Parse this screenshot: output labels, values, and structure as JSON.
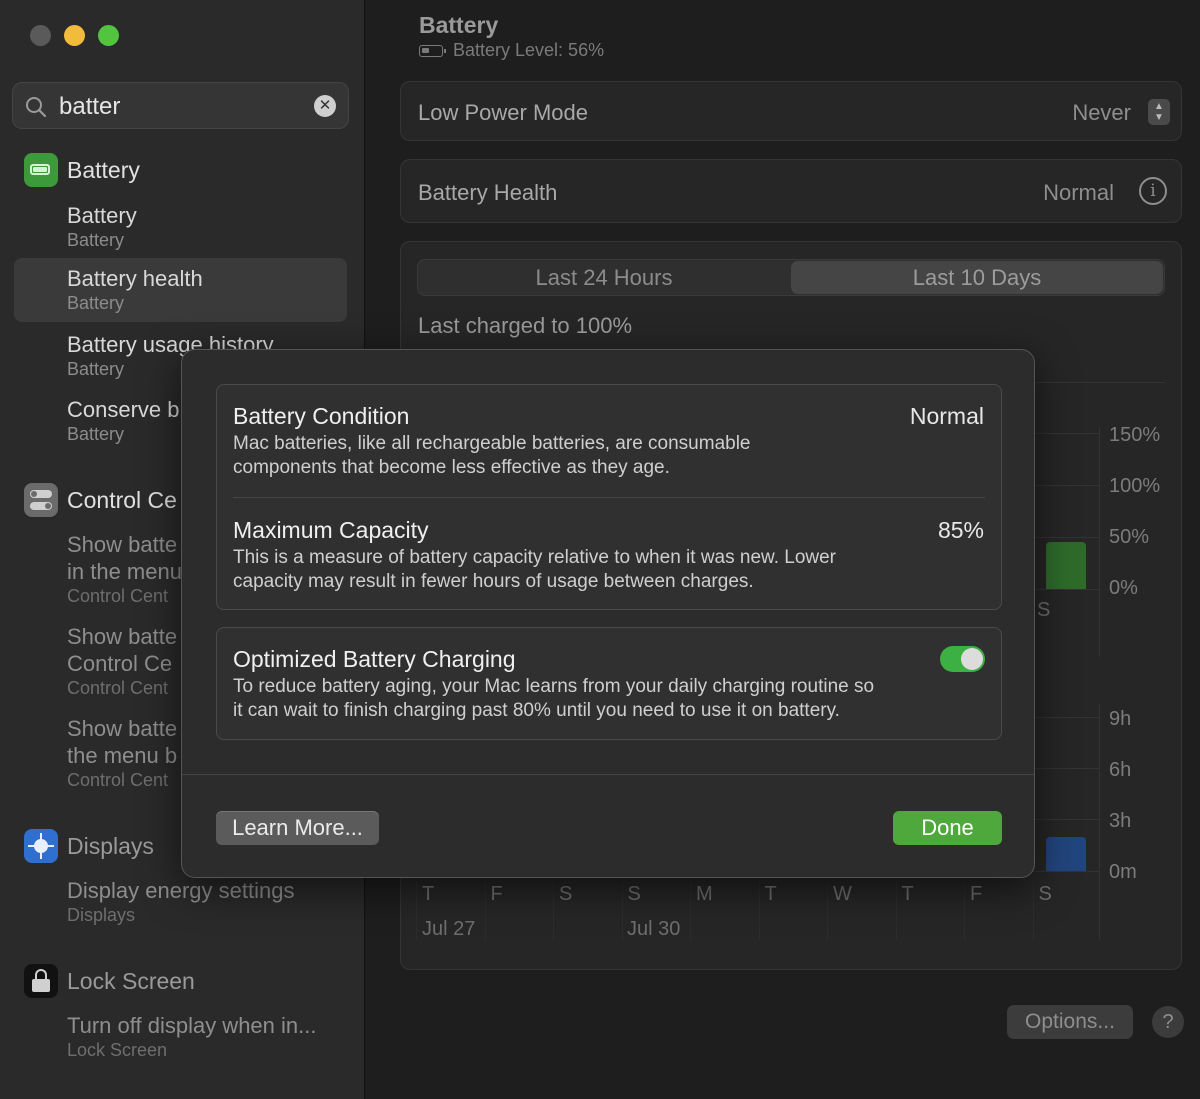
{
  "search": {
    "query": "batter"
  },
  "sidebar": {
    "groups": [
      {
        "label": "Battery",
        "items": [
          {
            "title": "Battery",
            "subtitle": "Battery"
          },
          {
            "title": "Battery health",
            "subtitle": "Battery"
          },
          {
            "title": "Battery usage history",
            "subtitle": "Battery"
          },
          {
            "title": "Conserve b",
            "subtitle": "Battery"
          }
        ]
      },
      {
        "label": "Control Ce",
        "items": [
          {
            "title": "Show batte",
            "title2": "in the menu",
            "subtitle": "Control Cent"
          },
          {
            "title": "Show batte",
            "title2": "Control Ce",
            "subtitle": "Control Cent"
          },
          {
            "title": "Show batte",
            "title2": "the menu b",
            "subtitle": "Control Cent"
          }
        ]
      },
      {
        "label": "Displays",
        "items": [
          {
            "title": "Display energy settings",
            "subtitle": "Displays"
          }
        ]
      },
      {
        "label": "Lock Screen",
        "items": [
          {
            "title": "Turn off display when in...",
            "subtitle": "Lock Screen"
          }
        ]
      }
    ]
  },
  "main": {
    "title": "Battery",
    "battery_level": "Battery Level: 56%",
    "low_power": {
      "label": "Low Power Mode",
      "value": "Never"
    },
    "health": {
      "label": "Battery Health",
      "value": "Normal"
    },
    "tabs": [
      "Last 24 Hours",
      "Last 10 Days"
    ],
    "last_charged": "Last charged to 100%",
    "options_label": "Options...",
    "help_label": "?"
  },
  "chart_data": [
    {
      "type": "bar",
      "title": "",
      "y_ticks": [
        "150%",
        "100%",
        "50%",
        "0%"
      ],
      "visible_categories": [
        "S"
      ],
      "values": [
        45
      ]
    },
    {
      "type": "bar",
      "title": "",
      "y_ticks": [
        "9h",
        "6h",
        "3h",
        "0m"
      ],
      "categories": [
        "T",
        "F",
        "S",
        "S",
        "M",
        "T",
        "W",
        "T",
        "F",
        "S"
      ],
      "date_labels": [
        "Jul 27",
        "Jul 30"
      ],
      "values": [
        null,
        null,
        null,
        null,
        null,
        null,
        null,
        null,
        null,
        2
      ]
    }
  ],
  "colors": {
    "accent_green": "#4ea83c",
    "bar_green": "#2e6b2a",
    "bar_blue": "#21457d"
  },
  "modal": {
    "condition": {
      "title": "Battery Condition",
      "value": "Normal",
      "desc1": "Mac batteries, like all rechargeable batteries, are consumable",
      "desc2": "components that become less effective as they age."
    },
    "capacity": {
      "title": "Maximum Capacity",
      "value": "85%",
      "desc1": "This is a measure of battery capacity relative to when it was new. Lower",
      "desc2": "capacity may result in fewer hours of usage between charges."
    },
    "optimized": {
      "title": "Optimized Battery Charging",
      "enabled": true,
      "desc1": "To reduce battery aging, your Mac learns from your daily charging routine so",
      "desc2": "it can wait to finish charging past 80% until you need to use it on battery."
    },
    "learn_more": "Learn More...",
    "done": "Done"
  }
}
